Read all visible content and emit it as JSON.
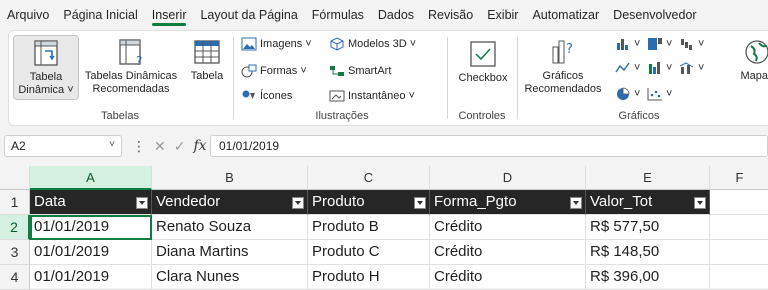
{
  "menu": {
    "tabs": [
      "Arquivo",
      "Página Inicial",
      "Inserir",
      "Layout da Página",
      "Fórmulas",
      "Dados",
      "Revisão",
      "Exibir",
      "Automatizar",
      "Desenvolvedor"
    ],
    "active": "Inserir"
  },
  "ribbon": {
    "tabelas": {
      "pivot_table": "Tabela\nDinâmica ˅",
      "recommended_pivots": "Tabelas Dinâmicas\nRecomendadas",
      "table": "Tabela",
      "label": "Tabelas"
    },
    "ilustracoes": {
      "images": "Imagens ˅",
      "shapes": "Formas ˅",
      "icons": "Ícones",
      "models3d": "Modelos 3D ˅",
      "smartart": "SmartArt",
      "screenshot": "Instantâneo ˅",
      "label": "Ilustrações"
    },
    "controles": {
      "checkbox": "Checkbox",
      "label": "Controles"
    },
    "graficos": {
      "recommended_charts": "Gráficos\nRecomendados",
      "maps": "Mapas",
      "label": "Gráficos"
    }
  },
  "formula_bar": {
    "name_box": "A2",
    "formula": "01/01/2019"
  },
  "grid": {
    "columns": [
      "A",
      "B",
      "C",
      "D",
      "E",
      "F"
    ],
    "selected_column": "A",
    "header_row": [
      "Data",
      "Vendedor",
      "Produto",
      "Forma_Pgto",
      "Valor_Tot"
    ],
    "rows": [
      {
        "num": "1"
      },
      {
        "num": "2",
        "cells": [
          "01/01/2019",
          "Renato Souza",
          "Produto B",
          "Crédito",
          "R$ 577,50"
        ]
      },
      {
        "num": "3",
        "cells": [
          "01/01/2019",
          "Diana Martins",
          "Produto C",
          "Crédito",
          "R$ 148,50"
        ]
      },
      {
        "num": "4",
        "cells": [
          "01/01/2019",
          "Clara Nunes",
          "Produto H",
          "Crédito",
          "R$ 396,00"
        ]
      }
    ],
    "selected_row": "2"
  },
  "colors": {
    "accent": "#107c41",
    "header_fill": "#262626"
  }
}
